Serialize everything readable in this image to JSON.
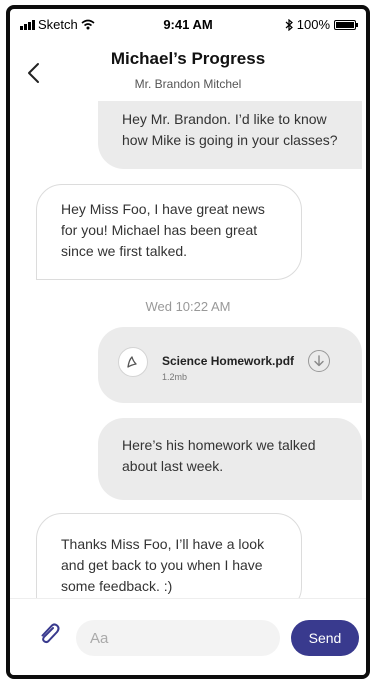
{
  "status_bar": {
    "carrier": "Sketch",
    "time": "9:41 AM",
    "battery": "100%",
    "battery_level": 1.0
  },
  "header": {
    "title": "Michael’s Progress",
    "subtitle": "Mr. Brandon Mitchel"
  },
  "messages": [
    {
      "text": "Hey Mr. Brandon. I’d like to know how Mike is going in your classes?"
    },
    {
      "text": "Hey Miss Foo, I have great news for you! Michael has been great since we first talked."
    },
    {
      "text": "Here’s his homework we talked about last week."
    },
    {
      "text": "Thanks Miss Foo, I’ll have a look and get back to you when I have some feedback. :)"
    }
  ],
  "timestamp": "Wed 10:22 AM",
  "attachment": {
    "file_name": "Science Homework.pdf",
    "file_size": "1.2mb"
  },
  "composer": {
    "placeholder": "Aa",
    "send_label": "Send"
  },
  "colors": {
    "accent": "#393a8e",
    "outgoing_bubble": "#ebebeb",
    "incoming_border": "#dcdcdc"
  }
}
